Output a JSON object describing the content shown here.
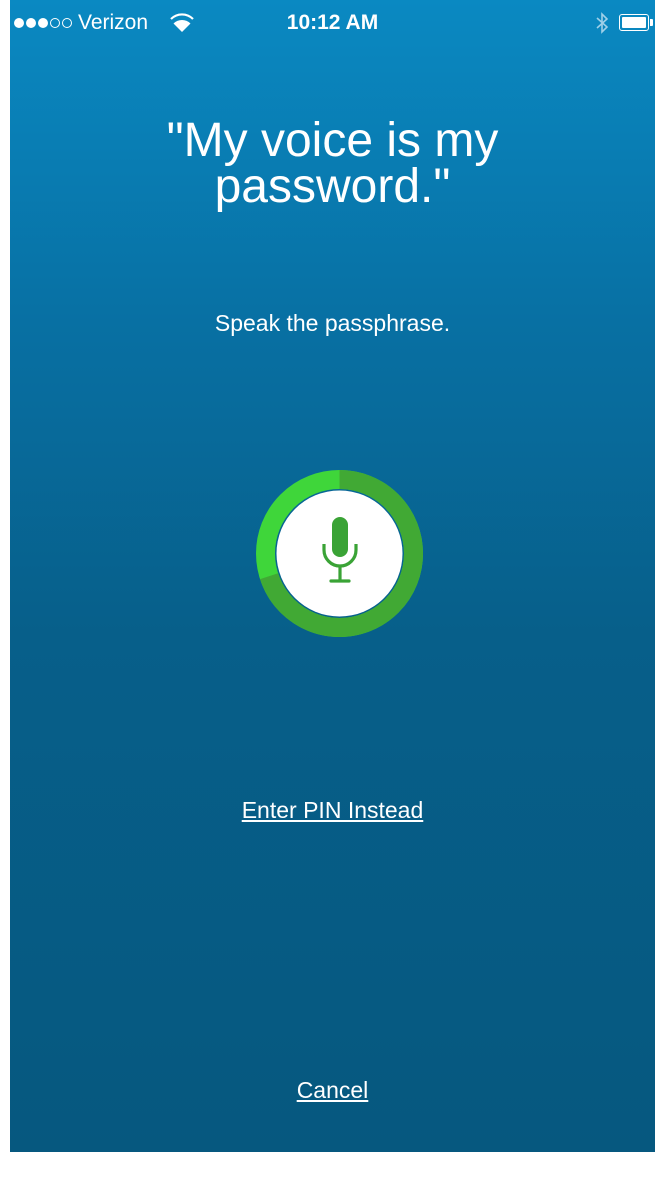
{
  "status_bar": {
    "signal_bars_filled": 3,
    "signal_bars_total": 5,
    "carrier": "Verizon",
    "time": "10:12 AM",
    "battery_level": 1.0
  },
  "prompt": {
    "passphrase_line1": "\"My voice is my",
    "passphrase_line2": "password.\"",
    "instruction": "Speak the passphrase."
  },
  "mic": {
    "icon": "microphone-icon",
    "progress": 0.7,
    "ring_color": "#3fd63a",
    "progress_color": "#41a934",
    "icon_color": "#3aa336"
  },
  "actions": {
    "enter_pin_label": "Enter PIN Instead",
    "cancel_label": "Cancel"
  },
  "colors": {
    "background_top": "#0a89c2",
    "background_bottom": "#06587f",
    "text": "#ffffff"
  }
}
